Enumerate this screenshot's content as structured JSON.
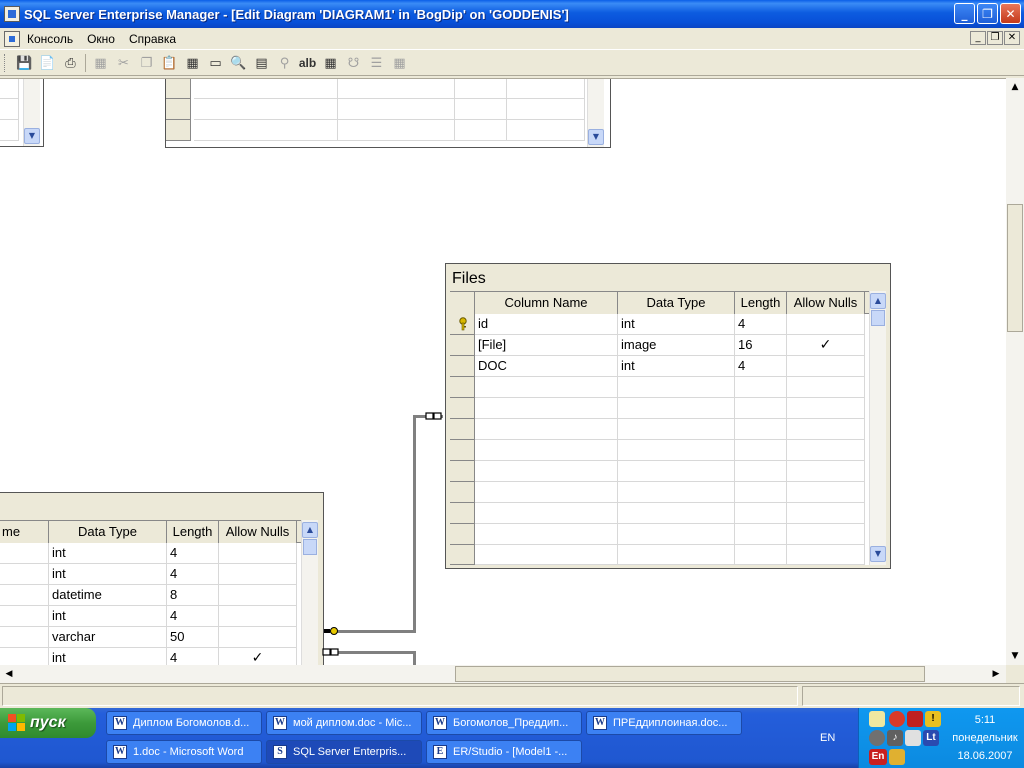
{
  "window": {
    "title": "SQL Server Enterprise Manager - [Edit Diagram 'DIAGRAM1' in 'BogDip' on 'GODDENIS']",
    "minimize": "_",
    "maximize": "❐",
    "close": "✕"
  },
  "menu": {
    "items": [
      "Консоль",
      "Окно",
      "Справка"
    ],
    "mdi_min": "_",
    "mdi_restore": "❐",
    "mdi_close": "✕"
  },
  "toolbar": {
    "alb_label": "alb"
  },
  "files_table": {
    "name": "Files",
    "columns": [
      "Column Name",
      "Data Type",
      "Length",
      "Allow Nulls"
    ],
    "rows": [
      {
        "name": "id",
        "type": "int",
        "length": "4",
        "nulls": "",
        "key": true
      },
      {
        "name": "[File]",
        "type": "image",
        "length": "16",
        "nulls": "✓"
      },
      {
        "name": "DOC",
        "type": "int",
        "length": "4",
        "nulls": ""
      }
    ]
  },
  "left_table": {
    "columns": [
      "me",
      "Data Type",
      "Length",
      "Allow Nulls"
    ],
    "rows": [
      {
        "type": "int",
        "length": "4",
        "nulls": ""
      },
      {
        "type": "int",
        "length": "4",
        "nulls": ""
      },
      {
        "type": "datetime",
        "length": "8",
        "nulls": ""
      },
      {
        "type": "int",
        "length": "4",
        "nulls": ""
      },
      {
        "type": "varchar",
        "length": "50",
        "nulls": ""
      },
      {
        "type": "int",
        "length": "4",
        "nulls": "✓"
      }
    ]
  },
  "taskbar": {
    "start_label": "пуск",
    "tasks_row1": [
      "Диплом Богомолов.d...",
      "мой диплом.doc - Mic...",
      "Богомолов_Преддип...",
      "ПРЕддиплоиная.doc..."
    ],
    "tasks_row2": [
      "1.doc - Microsoft Word",
      "SQL Server Enterpris...",
      "ER/Studio - [Model1 -..."
    ],
    "lang": "EN",
    "tray_lang": "En",
    "clock": {
      "time": "5:11",
      "day": "понедельник",
      "date": "18.06.2007"
    }
  },
  "colors": {
    "title_blue": "#0a5ee8",
    "start_green": "#3c9a3a",
    "taskbar_blue": "#245edb"
  }
}
